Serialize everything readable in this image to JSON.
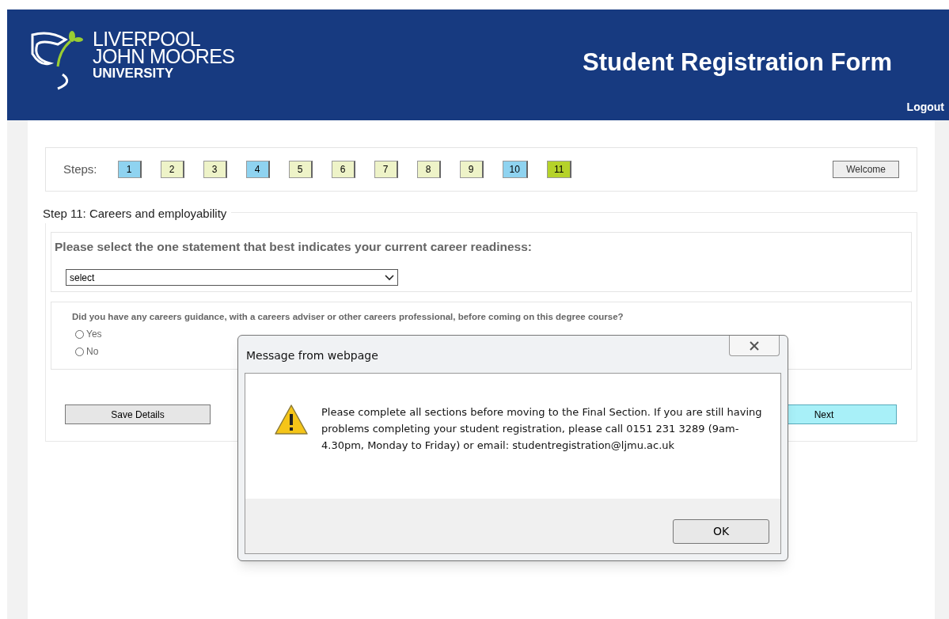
{
  "header": {
    "logo_lines": [
      "LIVERPOOL",
      "JOHN MOORES",
      "UNIVERSITY"
    ],
    "title": "Student Registration Form",
    "logout": "Logout"
  },
  "steps": {
    "label": "Steps:",
    "items": [
      {
        "label": "1",
        "color": "#8fd3f0"
      },
      {
        "label": "2",
        "color": "#eef3c8"
      },
      {
        "label": "3",
        "color": "#eef3c8"
      },
      {
        "label": "4",
        "color": "#8fd3f0"
      },
      {
        "label": "5",
        "color": "#eef3c8"
      },
      {
        "label": "6",
        "color": "#eef3c8"
      },
      {
        "label": "7",
        "color": "#eef3c8"
      },
      {
        "label": "8",
        "color": "#eef3c8"
      },
      {
        "label": "9",
        "color": "#eef3c8"
      },
      {
        "label": "10",
        "color": "#8fd3f0"
      },
      {
        "label": "11",
        "color": "#b5d22a"
      }
    ],
    "welcome": "Welcome"
  },
  "section": {
    "title": "Step 11: Careers and employability",
    "question_1": {
      "text": "Please select the one statement that best indicates your current career readiness:",
      "value": "select"
    },
    "question_2": {
      "text": "Did you have any careers guidance, with a careers adviser or other careers professional, before coming on this degree course?",
      "options": [
        {
          "label": "Yes",
          "selected": false
        },
        {
          "label": "No",
          "selected": false
        }
      ]
    },
    "save_button": "Save Details",
    "next_button": "Next"
  },
  "dialog": {
    "title": "Message from webpage",
    "message": "Please complete all sections before moving to the Final Section. If you are still having problems completing your student registration, please call 0151 231 3289 (9am-4.30pm, Monday to Friday) or email: studentregistration@ljmu.ac.uk",
    "ok": "OK"
  }
}
